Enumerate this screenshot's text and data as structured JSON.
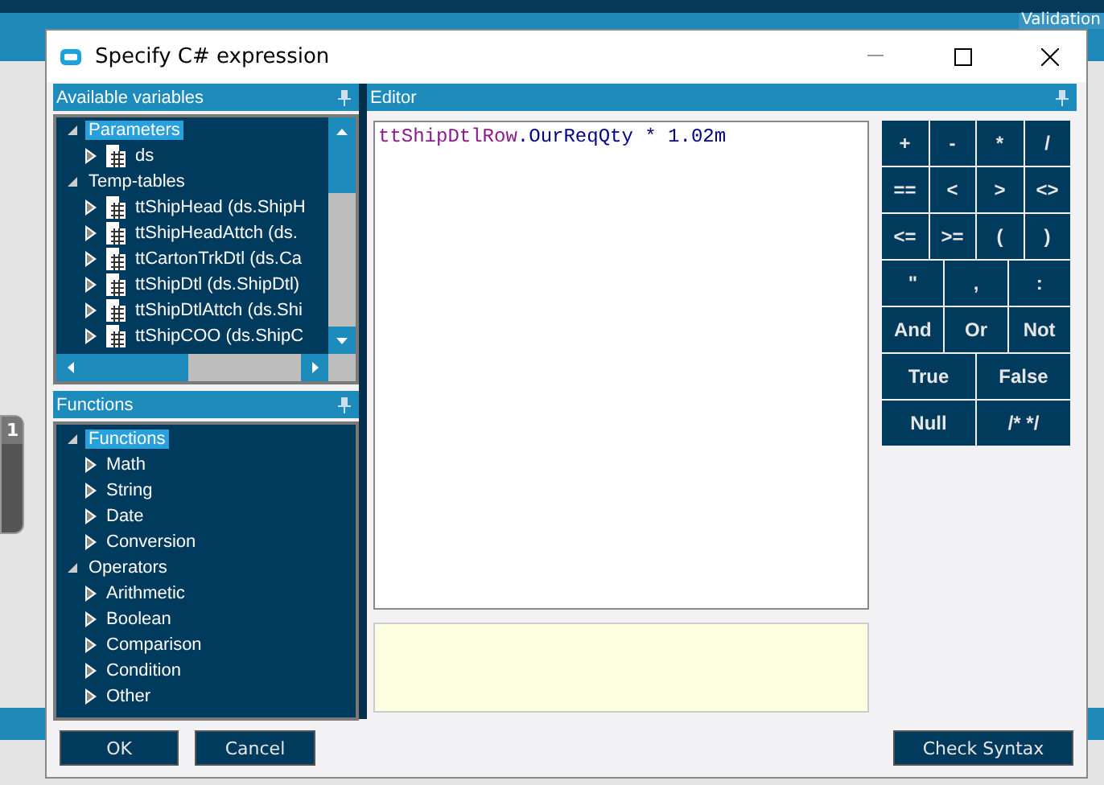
{
  "background": {
    "tab": "Validation",
    "badge": "1"
  },
  "dialog": {
    "title": "Specify C# expression",
    "variables": {
      "title": "Available variables",
      "tree": [
        {
          "label": "Parameters",
          "selected": true,
          "expanded": true,
          "children": [
            {
              "label": "ds",
              "kind": "table",
              "selected": false,
              "expanded": false
            }
          ]
        },
        {
          "label": "Temp-tables",
          "selected": false,
          "expanded": true,
          "children": [
            {
              "label": "ttShipHead (ds.ShipH",
              "kind": "table",
              "selected": false,
              "expanded": false
            },
            {
              "label": "ttShipHeadAttch (ds.",
              "kind": "table",
              "selected": false,
              "expanded": false
            },
            {
              "label": "ttCartonTrkDtl (ds.Ca",
              "kind": "table",
              "selected": false,
              "expanded": false
            },
            {
              "label": "ttShipDtl (ds.ShipDtl)",
              "kind": "table",
              "selected": false,
              "expanded": false
            },
            {
              "label": "ttShipDtlAttch (ds.Shi",
              "kind": "table",
              "selected": false,
              "expanded": false
            },
            {
              "label": "ttShipCOO (ds.ShipC",
              "kind": "table",
              "selected": false,
              "expanded": false
            }
          ]
        }
      ]
    },
    "functions": {
      "title": "Functions",
      "tree": [
        {
          "label": "Functions",
          "selected": true,
          "expanded": true,
          "children": [
            {
              "label": "Math",
              "selected": false,
              "expanded": false
            },
            {
              "label": "String",
              "selected": false,
              "expanded": false
            },
            {
              "label": "Date",
              "selected": false,
              "expanded": false
            },
            {
              "label": "Conversion",
              "selected": false,
              "expanded": false
            }
          ]
        },
        {
          "label": "Operators",
          "selected": false,
          "expanded": true,
          "children": [
            {
              "label": "Arithmetic",
              "selected": false,
              "expanded": false
            },
            {
              "label": "Boolean",
              "selected": false,
              "expanded": false
            },
            {
              "label": "Comparison",
              "selected": false,
              "expanded": false
            },
            {
              "label": "Condition",
              "selected": false,
              "expanded": false
            },
            {
              "label": "Other",
              "selected": false,
              "expanded": false
            }
          ]
        }
      ]
    },
    "editor": {
      "title": "Editor",
      "tokens": [
        {
          "text": "ttShipDtlRow",
          "kind": "identifier"
        },
        {
          "text": ".OurReqQty * 1.02m",
          "kind": "plain"
        }
      ]
    },
    "keypad": [
      [
        "+",
        "-",
        "*",
        "/"
      ],
      [
        "==",
        "<",
        ">",
        "<>"
      ],
      [
        "<=",
        ">=",
        "(",
        ")"
      ],
      [
        "\"",
        ",",
        ":"
      ],
      [
        "And",
        "Or",
        "Not"
      ],
      [
        "True",
        "False"
      ],
      [
        "Null",
        "/* */"
      ]
    ],
    "buttons": {
      "ok": "OK",
      "cancel": "Cancel",
      "check": "Check Syntax"
    }
  }
}
